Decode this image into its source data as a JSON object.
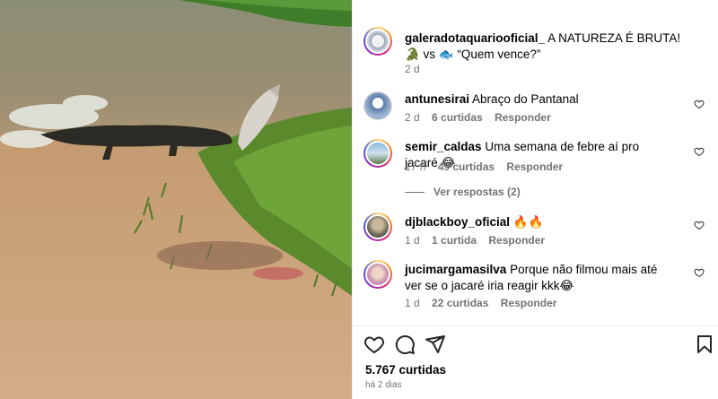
{
  "post": {
    "author": "galeradotaquariooficial_",
    "caption": "A NATUREZA É BRUTA! 🐊 vs 🐟 “Quem vence?”",
    "age": "2 d"
  },
  "comments": [
    {
      "user": "antunesirai",
      "text": "Abraço do Pantanal",
      "age": "2 d",
      "likes": "6 curtidas",
      "reply": "Responder"
    },
    {
      "user": "semir_caldas",
      "text": "Uma semana de febre aí pro jacaré 😂",
      "age": "17 h",
      "likes": "49 curtidas",
      "reply": "Responder",
      "view_replies": "Ver respostas (2)"
    },
    {
      "user": "djblackboy_oficial",
      "text": "🔥🔥",
      "age": "1 d",
      "likes": "1 curtida",
      "reply": "Responder"
    },
    {
      "user": "jucimargamasilva",
      "text": "Porque não filmou mais até ver se o jacaré iria reagir kkk😂",
      "age": "1 d",
      "likes": "22 curtidas",
      "reply": "Responder"
    }
  ],
  "footer": {
    "likes": "5.767 curtidas",
    "date": "há 2 dias"
  },
  "icons": {
    "like": "heart-icon",
    "comment": "comment-icon",
    "share": "share-icon",
    "save": "bookmark-icon"
  }
}
